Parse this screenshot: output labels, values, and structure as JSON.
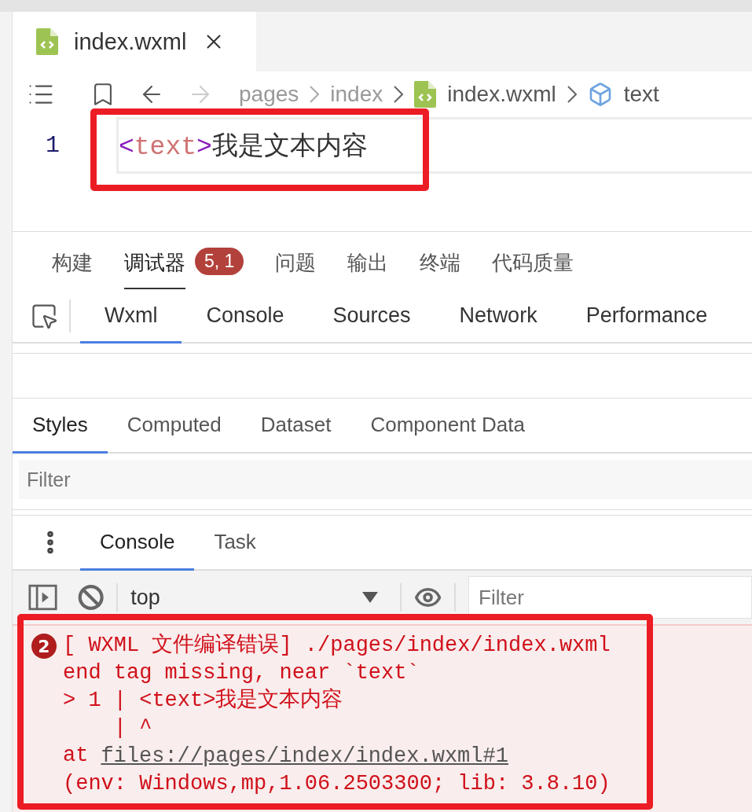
{
  "editor_tab": {
    "title": "index.wxml"
  },
  "breadcrumb": [
    {
      "label": "pages",
      "kind": "folder"
    },
    {
      "label": "index",
      "kind": "folder"
    },
    {
      "label": "index.wxml",
      "kind": "file"
    },
    {
      "label": "text",
      "kind": "element"
    }
  ],
  "code_lines": [
    {
      "number": "1",
      "open": "<",
      "tag": "text",
      "close": ">",
      "content": "我是文本内容"
    }
  ],
  "panel_tabs": [
    {
      "label": "构建",
      "selected": false
    },
    {
      "label": "调试器",
      "selected": true,
      "badge": "5, 1"
    },
    {
      "label": "问题",
      "selected": false
    },
    {
      "label": "输出",
      "selected": false
    },
    {
      "label": "终端",
      "selected": false
    },
    {
      "label": "代码质量",
      "selected": false
    }
  ],
  "devtools_tabs": [
    {
      "label": "Wxml",
      "selected": true
    },
    {
      "label": "Console",
      "selected": false
    },
    {
      "label": "Sources",
      "selected": false
    },
    {
      "label": "Network",
      "selected": false
    },
    {
      "label": "Performance",
      "selected": false
    }
  ],
  "styles_tabs": [
    {
      "label": "Styles",
      "selected": true
    },
    {
      "label": "Computed",
      "selected": false
    },
    {
      "label": "Dataset",
      "selected": false
    },
    {
      "label": "Component Data",
      "selected": false
    }
  ],
  "styles_filter": {
    "placeholder": "Filter"
  },
  "drawer_tabs": [
    {
      "label": "Console",
      "selected": true
    },
    {
      "label": "Task",
      "selected": false
    }
  ],
  "console_toolbar": {
    "context": "top",
    "filter_placeholder": "Filter"
  },
  "console_messages": [
    {
      "count": "2",
      "lines": [
        {
          "text": "[ WXML 文件编译错误] ./pages/index/index.wxml"
        },
        {
          "text": "end tag missing, near `text`"
        },
        {
          "text": "> 1 | <text>我是文本内容"
        },
        {
          "text": "    | ^"
        },
        {
          "text": "at",
          "link": "files://pages/index/index.wxml#1"
        },
        {
          "text": "(env: Windows,mp,1.06.2503300; lib: 3.8.10)"
        }
      ]
    }
  ]
}
